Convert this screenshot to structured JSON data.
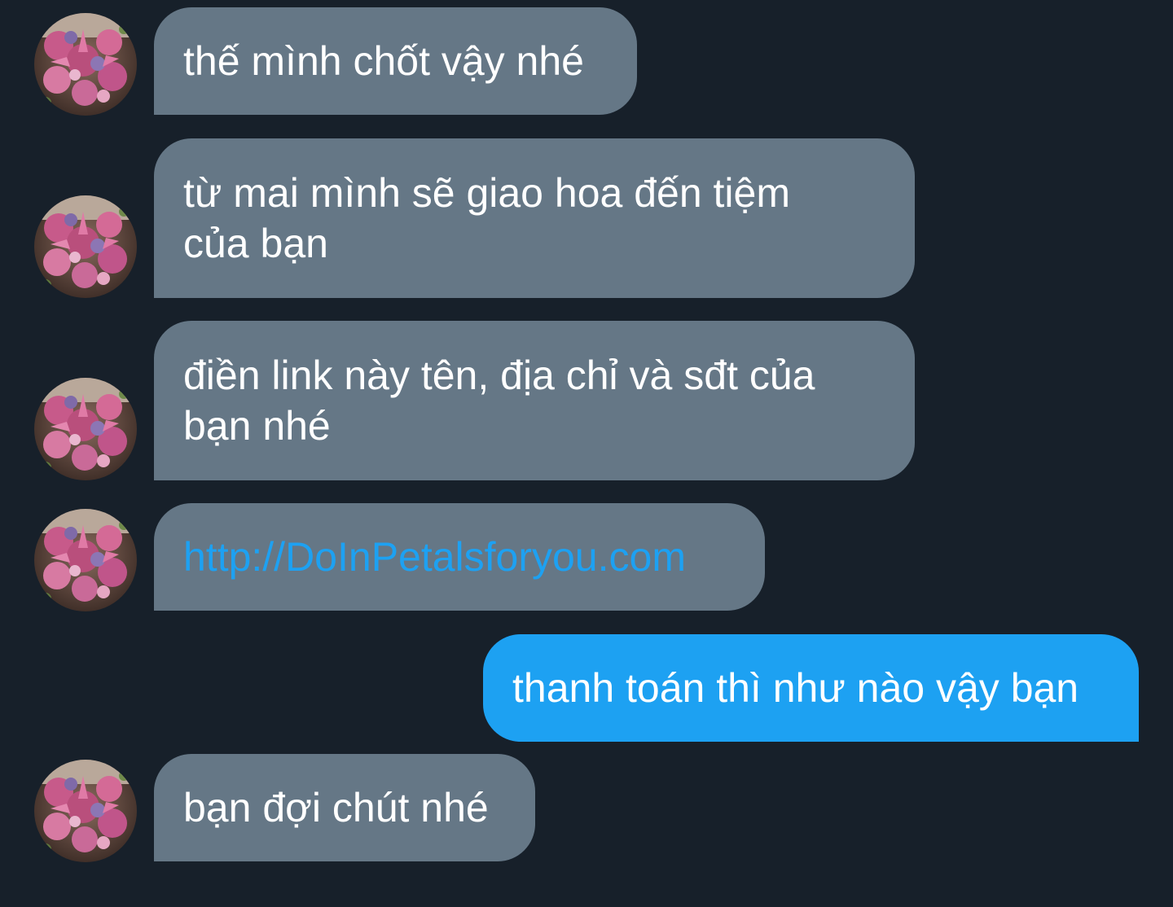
{
  "messages": [
    {
      "direction": "incoming",
      "text": "thế mình chốt vậy nhé"
    },
    {
      "direction": "incoming",
      "lines": [
        "từ mai mình sẽ giao hoa đến tiệm",
        "của bạn"
      ]
    },
    {
      "direction": "incoming",
      "lines": [
        "điền link này tên, địa chỉ và sđt của",
        "bạn nhé"
      ]
    },
    {
      "direction": "incoming",
      "link": "http://DoInPetalsforyou.com"
    },
    {
      "direction": "outgoing",
      "text": "thanh toán thì như nào vậy bạn"
    },
    {
      "direction": "incoming",
      "text": "bạn đợi chút nhé"
    }
  ],
  "avatar": {
    "icon": "flower-bouquet-avatar"
  },
  "colors": {
    "background": "#17202a",
    "incoming_bubble": "#657786",
    "outgoing_bubble": "#1da1f2",
    "link": "#1da1f2",
    "text": "#ffffff"
  }
}
